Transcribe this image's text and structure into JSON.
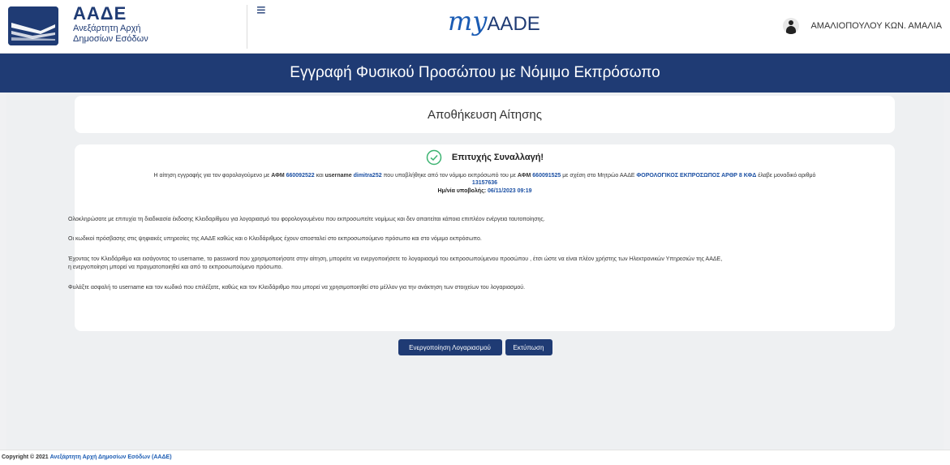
{
  "header": {
    "logo_title": "ΑΑΔΕ",
    "logo_sub1": "Ανεξάρτητη Αρχή",
    "logo_sub2": "Δημοσίων Εσόδων",
    "brand_my": "my",
    "brand_aade": "AADE",
    "user_name": "ΑΜΑΛΙΟΠΟΥΛΟΥ ΚΩΝ. ΑΜΑΛΙΑ"
  },
  "title": "Εγγραφή Φυσικού Προσώπου με Νόμιμο Εκπρόσωπο",
  "save_card": {
    "label": "Αποθήκευση Αίτησης"
  },
  "result": {
    "success": "Επιτυχής Συναλλαγή!",
    "msg_1": "Η αίτηση εγγραφής για τον φορολογούμενο με ",
    "afm_label": "ΑΦΜ",
    "afm": "660092522",
    "msg_2": " και ",
    "username_label": "username",
    "username": "dimitra252",
    "msg_3": " που υποβλήθηκε από τον νόμιμο εκπρόσωπό του με ",
    "afm2_label": "ΑΦΜ",
    "afm2": "660091525",
    "msg_4": " με σχέση στο Μητρώο ΑΑΔΕ ",
    "relation": "ΦΟΡΟΛΟΓΙΚΟΣ ΕΚΠΡΟΣΩΠΟΣ ΑΡΘΡ 8 ΚΦΔ",
    "msg_5": " έλαβε μοναδικό αριθμό",
    "number": "13157636",
    "date_label": "Ημ/νία υποβολής: ",
    "date": "06/11/2023 09:19"
  },
  "paragraphs": {
    "p1": "Ολοκληρώσατε με επιτυχία τη διαδικασία έκδοσης Κλειδαρίθμου για λογαριασμό του φορολογουμένου που εκπροσωπείτε νομίμως και δεν απαιτείται κάποια επιπλέον ενέργεια ταυτοποίησης.",
    "p2": "Οι κωδικοί πρόσβασης στις ψηφιακές υπηρεσίες της ΑΑΔΕ καθώς και ο Κλειδάριθμος έχουν αποσταλεί στο εκπροσωπούμενο πρόσωπο και στο νόμιμο εκπρόσωπο.",
    "p3a": "Έχοντας τον Κλειδάριθμο και εισάγοντας το username, το password που χρησιμοποιήσατε στην αίτηση, μπορείτε να ενεργοποιήσετε το λογαριασμό του εκπροσωπούμενου προσώπου , έτσι ώστε να είναι πλέον χρήστης των Ηλεκτρονικών Υπηρεσιών της ΑΑΔΕ,",
    "p3b": "η ενεργοποίηση μπορεί να πραγματοποιηθεί και από το εκπροσωπούμενο πρόσωπο.",
    "p4": "Φυλάξτε ασφαλή το username και τον κωδικό που επιλέξατε, καθώς και τον Κλειδάριθμο που μπορεί να χρησιμοποιηθεί στο μέλλον για την ανάκτηση των στοιχείων του λογαριασμού."
  },
  "buttons": {
    "activate": "Ενεργοποίηση Λογαριασμού",
    "print": "Εκτύπωση"
  },
  "footer": {
    "copyright": "Copyright © 2021 ",
    "link": "Ανεξάρτητη Αρχή Δημοσίων Εσόδων (ΑΑΔΕ)"
  },
  "colors": {
    "primary": "#1f3b74",
    "link": "#1a4fa3",
    "success": "#3cb371"
  }
}
